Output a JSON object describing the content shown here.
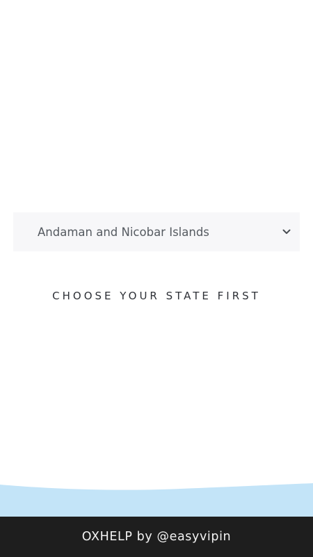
{
  "state_selector": {
    "selected_value": "Andaman and Nicobar Islands",
    "chevron_icon": "chevron-down-icon"
  },
  "prompt": {
    "text": "CHOOSE YOUR STATE FIRST"
  },
  "footer": {
    "credit": "OXHELP by @easyvipin"
  },
  "colors": {
    "select_background": "#f7f7f9",
    "wave": "#c3e4f8",
    "footer_background": "#1e1e1e"
  }
}
